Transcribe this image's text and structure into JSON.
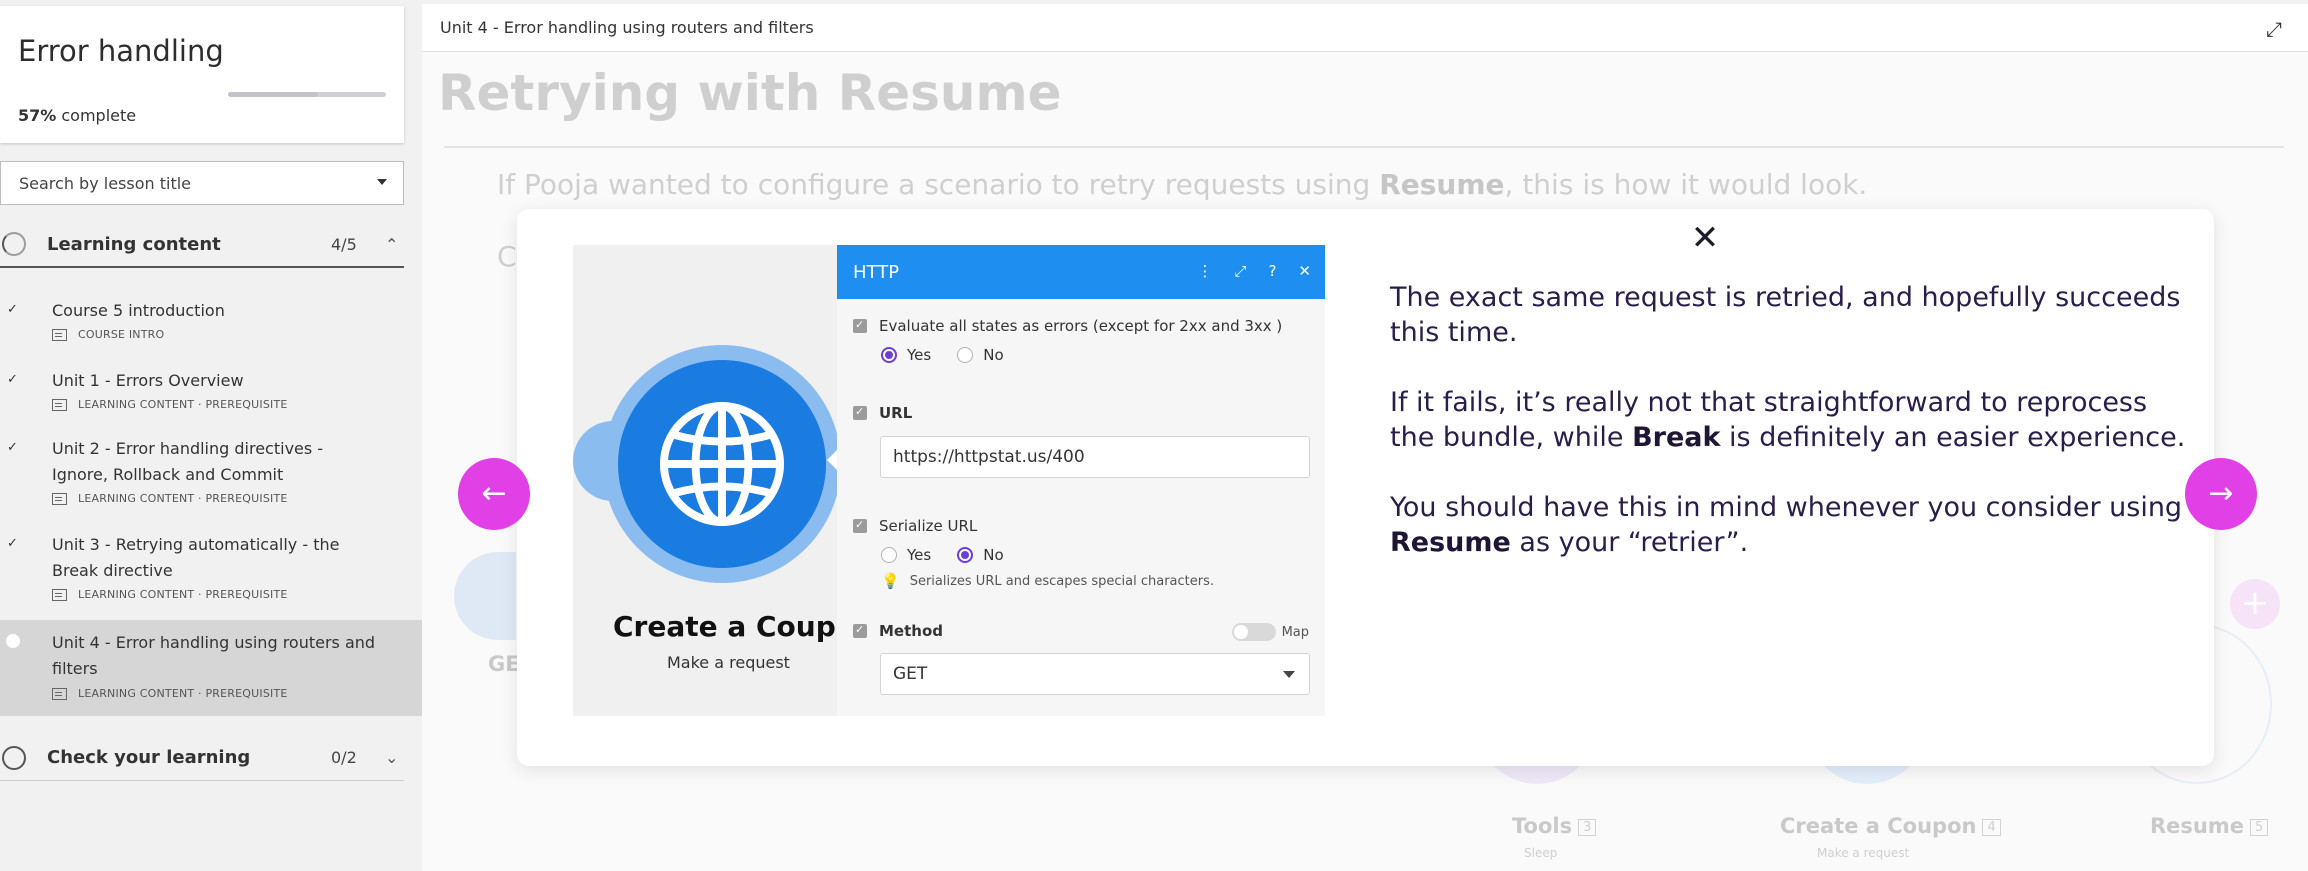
{
  "course": {
    "title": "Error handling",
    "progress_pct": 57,
    "progress_value": "57%",
    "progress_suffix": " complete"
  },
  "search": {
    "placeholder": "Search by lesson title"
  },
  "sections": [
    {
      "label": "Learning content",
      "count": "4/5",
      "chevron": "⌃",
      "lessons": [
        {
          "title": "Course 5 introduction",
          "meta": "COURSE INTRO",
          "done": true
        },
        {
          "title": "Unit 1 - Errors Overview",
          "meta": "LEARNING CONTENT · PREREQUISITE",
          "done": true
        },
        {
          "title": "Unit 2 - Error handling directives - Ignore, Rollback and Commit",
          "meta": "LEARNING CONTENT · PREREQUISITE",
          "done": true
        },
        {
          "title": "Unit 3 - Retrying automatically - the Break directive",
          "meta": "LEARNING CONTENT · PREREQUISITE",
          "done": true
        },
        {
          "title": "Unit 4 - Error handling using routers and filters",
          "meta": "LEARNING CONTENT · PREREQUISITE",
          "done": false,
          "active": true
        }
      ]
    },
    {
      "label": "Check your learning",
      "count": "0/2",
      "chevron": "⌄"
    }
  ],
  "topbar": {
    "breadcrumb": "Unit 4 - Error handling using routers and filters",
    "expand_icon": "expand-icon"
  },
  "lesson": {
    "heading": "Retrying with Resume",
    "para_before": "If Pooja wanted to configure a scenario to retry requests using ",
    "para_bold": "Resume",
    "para_after": ", this is how it would look.",
    "faded_c": "C"
  },
  "background_modules": {
    "left_label": "GE",
    "tools_label": "Tools",
    "tools_badge": "3",
    "tools_sub": "Sleep",
    "coupon_label": "Create a Coupon",
    "coupon_badge": "4",
    "coupon_sub": "Make a request",
    "resume_label": "Resume",
    "resume_badge": "5",
    "plus": "+"
  },
  "overlay": {
    "close": "✕",
    "prev": "←",
    "next": "→",
    "module_title": "Create a Coupon",
    "module_sub": "Make a request",
    "http": {
      "title": "HTTP",
      "icons": [
        "⋮",
        "⤢",
        "?",
        "✕"
      ],
      "evaluate_label": "Evaluate all states as errors (except for 2xx and 3xx )",
      "evaluate_yes": "Yes",
      "evaluate_no": "No",
      "url_label": "URL",
      "url_value": "https://httpstat.us/400",
      "serialize_label": "Serialize URL",
      "serialize_yes": "Yes",
      "serialize_no": "No",
      "serialize_hint": "Serializes URL and escapes special characters.",
      "method_label": "Method",
      "map_label": "Map",
      "method_value": "GET"
    },
    "text": {
      "p1": "The exact same request is retried, and hopefully succeeds this time.",
      "p2_before": "If it fails, it’s really not that straightforward to reprocess the bundle, while ",
      "p2_bold": "Break",
      "p2_after": " is definitely an easier experience.",
      "p3_before": "You should have this in mind whenever you consider using ",
      "p3_bold": "Resume",
      "p3_after": " as your “retrier”."
    }
  },
  "colors": {
    "accent_magenta": "#e040e6",
    "http_blue": "#1e8ef0",
    "globe_blue": "#1a7be0",
    "radio_purple": "#6b3fd4",
    "text_dark": "#2b1d4a"
  }
}
